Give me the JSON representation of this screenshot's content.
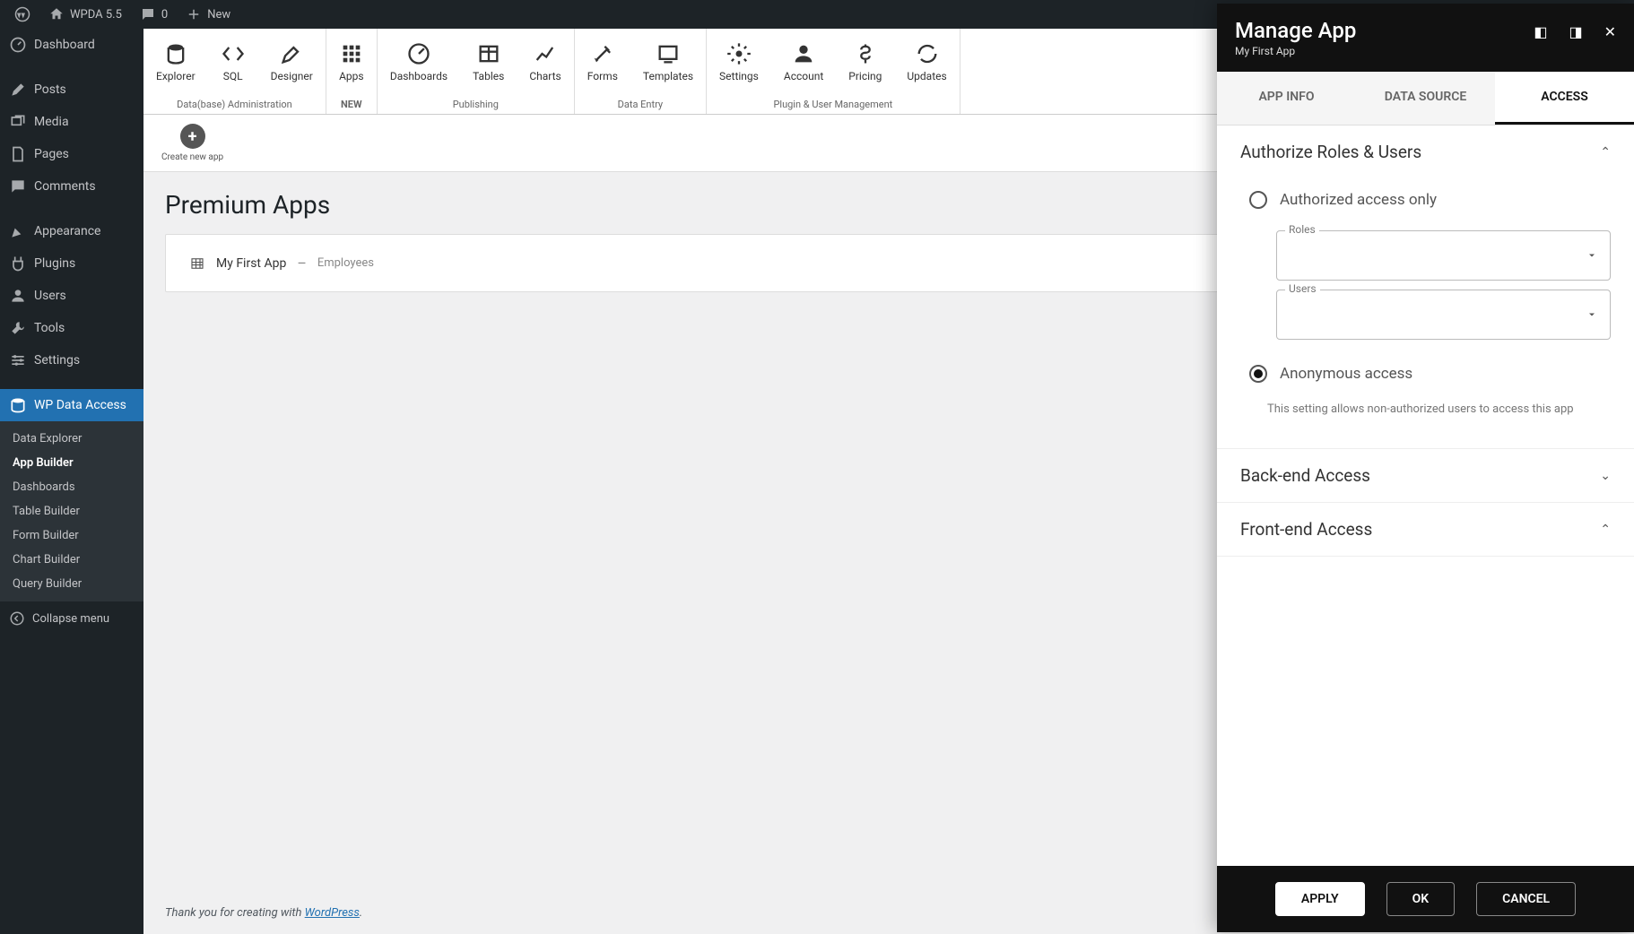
{
  "adminBar": {
    "siteName": "WPDA 5.5",
    "comments": "0",
    "new": "New"
  },
  "sidebar": {
    "dashboard": "Dashboard",
    "posts": "Posts",
    "media": "Media",
    "pages": "Pages",
    "comments": "Comments",
    "appearance": "Appearance",
    "plugins": "Plugins",
    "users": "Users",
    "tools": "Tools",
    "settings": "Settings",
    "wpda": "WP Data Access",
    "sub": {
      "dataExplorer": "Data Explorer",
      "appBuilder": "App Builder",
      "dashboards": "Dashboards",
      "tableBuilder": "Table Builder",
      "formBuilder": "Form Builder",
      "chartBuilder": "Chart Builder",
      "queryBuilder": "Query Builder"
    },
    "collapse": "Collapse menu"
  },
  "toolbar": {
    "explorer": "Explorer",
    "sql": "SQL",
    "designer": "Designer",
    "apps": "Apps",
    "appsNew": "NEW",
    "dashboards": "Dashboards",
    "tables": "Tables",
    "charts": "Charts",
    "forms": "Forms",
    "templates": "Templates",
    "settings": "Settings",
    "account": "Account",
    "pricing": "Pricing",
    "updates": "Updates",
    "groups": {
      "dbadmin": "Data(base) Administration",
      "publishing": "Publishing",
      "dataentry": "Data Entry",
      "plugin": "Plugin & User Management"
    }
  },
  "createApp": "Create new app",
  "page": {
    "title": "Premium Apps",
    "app": {
      "name": "My First App",
      "sep": "–",
      "table": "Employees"
    }
  },
  "footer": {
    "thanks": "Thank you for creating with ",
    "wp": "WordPress",
    "dot": "."
  },
  "drawer": {
    "title": "Manage App",
    "subtitle": "My First App",
    "tabs": {
      "info": "APP INFO",
      "datasource": "DATA SOURCE",
      "access": "ACCESS"
    },
    "sections": {
      "authorize": "Authorize Roles & Users",
      "backend": "Back-end Access",
      "frontend": "Front-end Access"
    },
    "radio": {
      "authorized": "Authorized access only",
      "anonymous": "Anonymous access"
    },
    "fields": {
      "roles": "Roles",
      "users": "Users"
    },
    "helper": "This setting allows non-authorized users to access this app",
    "buttons": {
      "apply": "APPLY",
      "ok": "OK",
      "cancel": "CANCEL"
    }
  }
}
